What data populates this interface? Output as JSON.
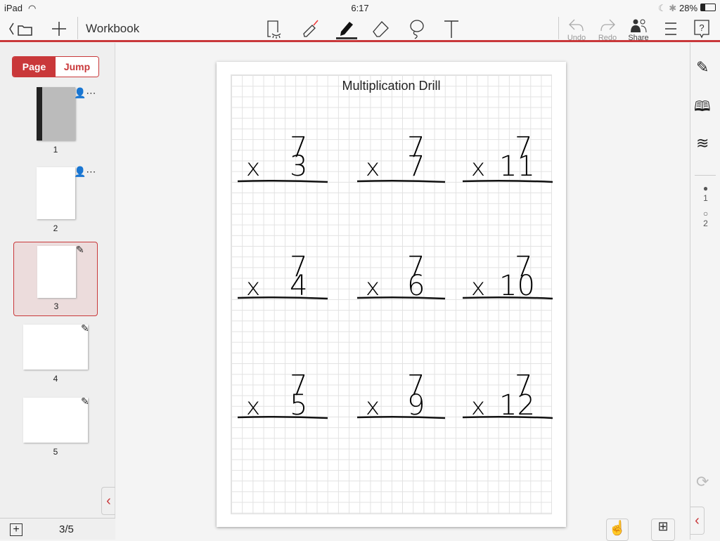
{
  "status": {
    "device": "iPad",
    "time": "6:17 PM",
    "battery": "28%"
  },
  "toolbar": {
    "title": "Workbook",
    "undo": "Undo",
    "redo": "Redo",
    "share": "Share"
  },
  "sidebar": {
    "page_tab": "Page",
    "jump_tab": "Jump",
    "thumbs": [
      {
        "label": "1"
      },
      {
        "label": "2"
      },
      {
        "label": "3",
        "selected": true
      },
      {
        "label": "4"
      },
      {
        "label": "5"
      }
    ],
    "page_counter": "3/5"
  },
  "page": {
    "title": "Multiplication Drill",
    "problems": [
      {
        "top": "7",
        "bottom": "3"
      },
      {
        "top": "7",
        "bottom": "7"
      },
      {
        "top": "7",
        "bottom": "11"
      },
      {
        "top": "7",
        "bottom": "4"
      },
      {
        "top": "7",
        "bottom": "6"
      },
      {
        "top": "7",
        "bottom": "10"
      },
      {
        "top": "7",
        "bottom": "5"
      },
      {
        "top": "7",
        "bottom": "9"
      },
      {
        "top": "7",
        "bottom": "12"
      }
    ],
    "times": "x"
  },
  "rightbar": {
    "users": [
      "1",
      "2"
    ]
  },
  "colors": {
    "accent": "#c9383a",
    "selected_bg": "#ecdcdc"
  }
}
